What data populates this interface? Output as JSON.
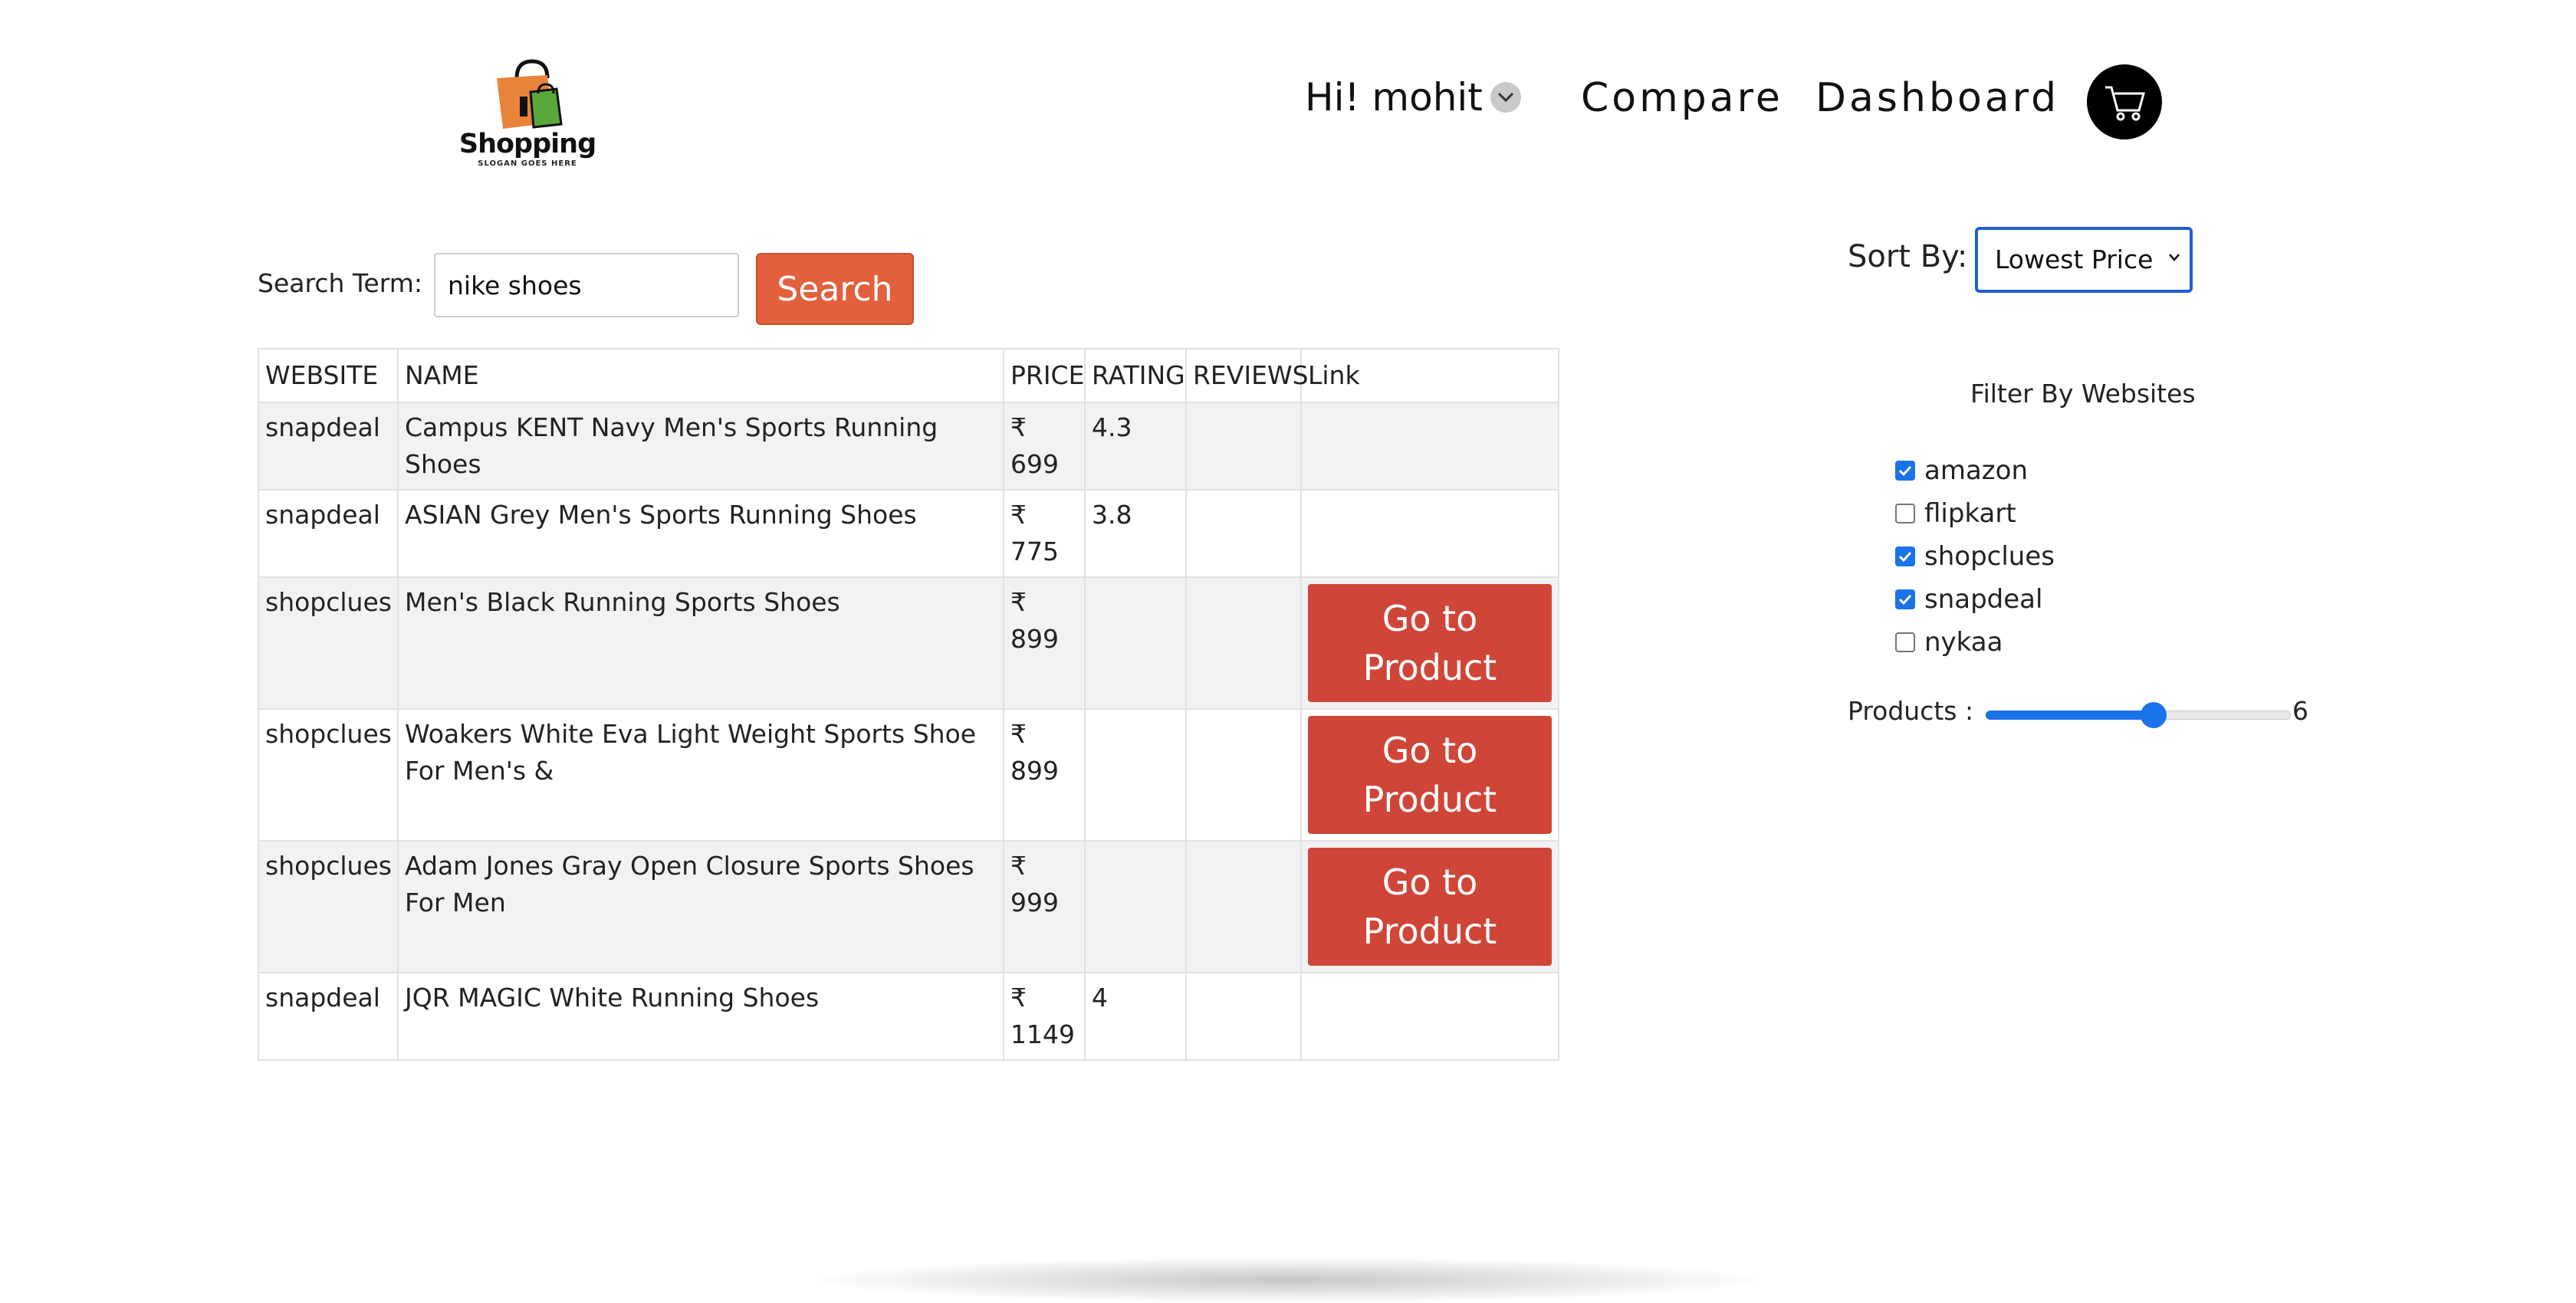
{
  "header": {
    "logo": {
      "word": "Shopping",
      "slogan": "SLOGAN GOES HERE"
    },
    "user_greeting": "Hi! mohit",
    "compare_label": "Compare",
    "dashboard_label": "Dashboard"
  },
  "search": {
    "label": "Search Term:",
    "value": "nike shoes",
    "button_label": "Search"
  },
  "table": {
    "columns": [
      "WEBSITE",
      "NAME",
      "PRICE",
      "RATING",
      "REVIEWS",
      "Link"
    ],
    "link_button_label": "Go to Product",
    "rows": [
      {
        "website": "snapdeal",
        "name": "Campus KENT Navy Men's Sports Running Shoes",
        "currency": "₹",
        "price": "699",
        "rating": "4.3",
        "reviews": "",
        "has_link": false
      },
      {
        "website": "snapdeal",
        "name": "ASIAN Grey Men's Sports Running Shoes",
        "currency": "₹",
        "price": "775",
        "rating": "3.8",
        "reviews": "",
        "has_link": false
      },
      {
        "website": "shopclues",
        "name": "Men's Black Running Sports Shoes",
        "currency": "₹",
        "price": "899",
        "rating": "",
        "reviews": "",
        "has_link": true
      },
      {
        "website": "shopclues",
        "name": "Woakers White Eva Light Weight Sports Shoe For Men's &",
        "currency": "₹",
        "price": "899",
        "rating": "",
        "reviews": "",
        "has_link": true
      },
      {
        "website": "shopclues",
        "name": "Adam Jones Gray Open Closure Sports Shoes For Men",
        "currency": "₹",
        "price": "999",
        "rating": "",
        "reviews": "",
        "has_link": true
      },
      {
        "website": "snapdeal",
        "name": "JQR MAGIC White Running Shoes",
        "currency": "₹",
        "price": "1149",
        "rating": "4",
        "reviews": "",
        "has_link": false
      }
    ]
  },
  "sidebar": {
    "sort_label": "Sort By:",
    "sort_value": "Lowest Price",
    "filter_title": "Filter By Websites",
    "filters": [
      {
        "label": "amazon",
        "checked": true
      },
      {
        "label": "flipkart",
        "checked": false
      },
      {
        "label": "shopclues",
        "checked": true
      },
      {
        "label": "snapdeal",
        "checked": true
      },
      {
        "label": "nykaa",
        "checked": false
      }
    ],
    "products_label": "Products :",
    "products_value": "6",
    "products_fraction": 0.55
  },
  "colors": {
    "search_button": "#e2603c",
    "link_button": "#cf4638",
    "accent": "#1a73e8"
  },
  "icons": {
    "user_menu": "chevron-down-icon",
    "cart": "cart-icon",
    "logo": "shopping-bag-icon"
  }
}
